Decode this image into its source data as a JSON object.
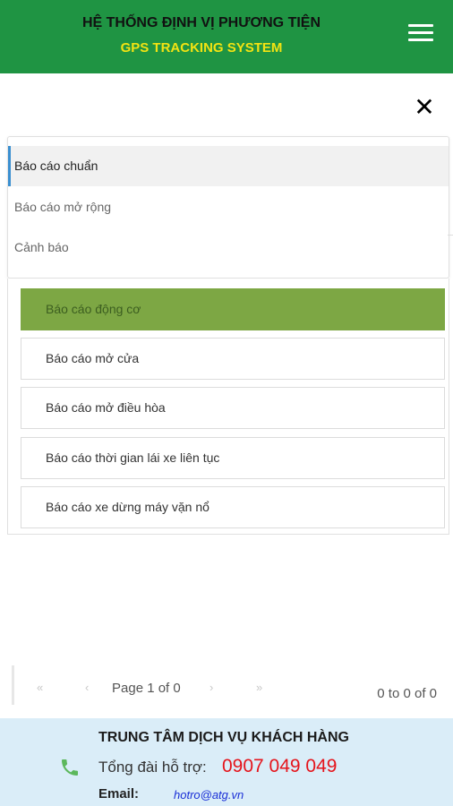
{
  "header": {
    "title": "HỆ THỐNG ĐỊNH VỊ PHƯƠNG TIỆN",
    "subtitle": "GPS TRACKING SYSTEM",
    "menu_icon": "hamburger-menu-icon",
    "colors": {
      "background": "#1f9443",
      "subtitle": "#f2e312"
    }
  },
  "close_icon": {
    "icon": "close-icon",
    "glyph": "✕"
  },
  "tabs": [
    {
      "label": "Báo cáo chuẩn",
      "active": true
    },
    {
      "label": "Báo cáo mở rộng",
      "active": false
    },
    {
      "label": "Cảnh báo",
      "active": false
    }
  ],
  "reports": [
    {
      "label": "Báo cáo động cơ",
      "active": true
    },
    {
      "label": "Báo cáo mở cửa",
      "active": false
    },
    {
      "label": "Báo cáo mở điều hòa",
      "active": false
    },
    {
      "label": "Báo cáo thời gian lái xe liên tục",
      "active": false
    },
    {
      "label": "Báo cáo xe dừng máy vặn nổ",
      "active": false
    }
  ],
  "pagination": {
    "first": "«",
    "prev": "‹",
    "page_text": "Page 1 of 0",
    "next": "›",
    "last": "»",
    "count": "0 to 0 of 0"
  },
  "footer": {
    "title": "TRUNG TÂM DỊCH VỤ KHÁCH HÀNG",
    "phone_icon": "phone-icon",
    "hotline_label": "Tổng đài hỗ trợ:",
    "hotline_number": "0907 049 049",
    "email_label": "Email:",
    "email_value": "hotro@atg.vn",
    "colors": {
      "background": "#daedf8",
      "hotline": "#e5141b",
      "email": "#1a2fd6"
    }
  },
  "accent_colors": {
    "active_report": "#7da744",
    "active_tab_border": "#3a8fd0"
  }
}
